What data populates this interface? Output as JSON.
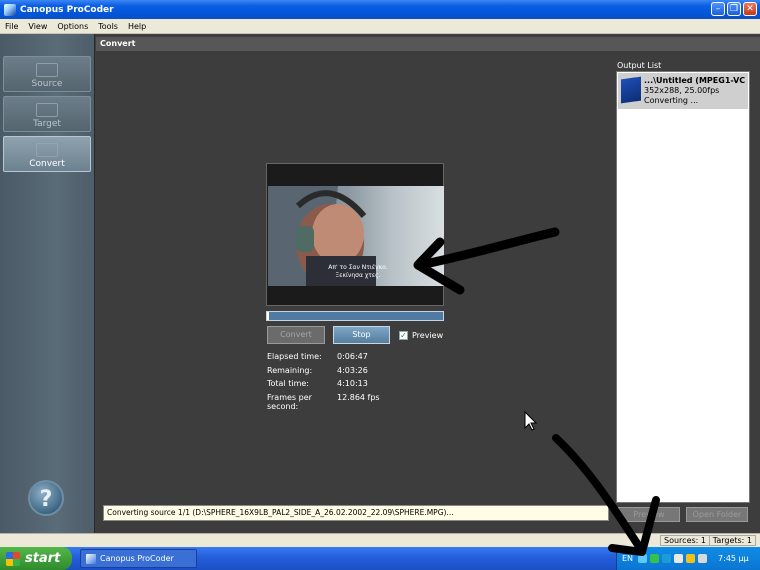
{
  "window": {
    "title": "Canopus ProCoder"
  },
  "menu": [
    "File",
    "View",
    "Options",
    "Tools",
    "Help"
  ],
  "nav": {
    "source": "Source",
    "target": "Target",
    "convert": "Convert"
  },
  "main": {
    "header": "Convert"
  },
  "video": {
    "subtitle_line1": "Απ' το Σαν Ντιέγκο.",
    "subtitle_line2": "Ξεκίνησα χτες."
  },
  "progress": {
    "percent": 1
  },
  "controls": {
    "convert_label": "Convert",
    "stop_label": "Stop",
    "preview_label": "Preview",
    "preview_checked": true
  },
  "stats": {
    "elapsed_label": "Elapsed time:",
    "elapsed": "0:06:47",
    "remaining_label": "Remaining:",
    "remaining": "4:03:26",
    "total_label": "Total time:",
    "total": "4:10:13",
    "fps_label": "Frames per second:",
    "fps": "12.864 fps"
  },
  "output": {
    "label": "Output List",
    "item": {
      "title": "...\\Untitled (MPEG1-VC",
      "details": "352x288, 25.00fps",
      "status": "Converting ..."
    },
    "preview_btn": "Preview",
    "open_folder_btn": "Open Folder"
  },
  "status_message": "Converting source 1/1 (D:\\SPHERE_16X9LB_PAL2_SIDE_A_26.02.2002_22.09\\SPHERE.MPG)...",
  "statusbar": {
    "sources": "Sources: 1",
    "targets": "Targets: 1"
  },
  "taskbar": {
    "start": "start",
    "app": "Canopus ProCoder",
    "lang": "EN",
    "clock": "7:45 μμ"
  },
  "colors": {
    "accent": "#245edb",
    "panel": "#3d3d3d",
    "nav": "#5a6c78"
  }
}
